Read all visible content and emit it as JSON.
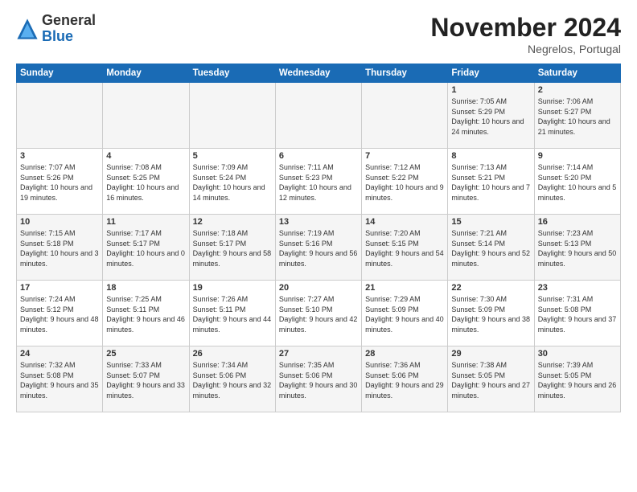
{
  "logo": {
    "general": "General",
    "blue": "Blue"
  },
  "title": "November 2024",
  "location": "Negrelos, Portugal",
  "days_of_week": [
    "Sunday",
    "Monday",
    "Tuesday",
    "Wednesday",
    "Thursday",
    "Friday",
    "Saturday"
  ],
  "weeks": [
    [
      {
        "num": "",
        "info": ""
      },
      {
        "num": "",
        "info": ""
      },
      {
        "num": "",
        "info": ""
      },
      {
        "num": "",
        "info": ""
      },
      {
        "num": "",
        "info": ""
      },
      {
        "num": "1",
        "info": "Sunrise: 7:05 AM\nSunset: 5:29 PM\nDaylight: 10 hours and 24 minutes."
      },
      {
        "num": "2",
        "info": "Sunrise: 7:06 AM\nSunset: 5:27 PM\nDaylight: 10 hours and 21 minutes."
      }
    ],
    [
      {
        "num": "3",
        "info": "Sunrise: 7:07 AM\nSunset: 5:26 PM\nDaylight: 10 hours and 19 minutes."
      },
      {
        "num": "4",
        "info": "Sunrise: 7:08 AM\nSunset: 5:25 PM\nDaylight: 10 hours and 16 minutes."
      },
      {
        "num": "5",
        "info": "Sunrise: 7:09 AM\nSunset: 5:24 PM\nDaylight: 10 hours and 14 minutes."
      },
      {
        "num": "6",
        "info": "Sunrise: 7:11 AM\nSunset: 5:23 PM\nDaylight: 10 hours and 12 minutes."
      },
      {
        "num": "7",
        "info": "Sunrise: 7:12 AM\nSunset: 5:22 PM\nDaylight: 10 hours and 9 minutes."
      },
      {
        "num": "8",
        "info": "Sunrise: 7:13 AM\nSunset: 5:21 PM\nDaylight: 10 hours and 7 minutes."
      },
      {
        "num": "9",
        "info": "Sunrise: 7:14 AM\nSunset: 5:20 PM\nDaylight: 10 hours and 5 minutes."
      }
    ],
    [
      {
        "num": "10",
        "info": "Sunrise: 7:15 AM\nSunset: 5:18 PM\nDaylight: 10 hours and 3 minutes."
      },
      {
        "num": "11",
        "info": "Sunrise: 7:17 AM\nSunset: 5:17 PM\nDaylight: 10 hours and 0 minutes."
      },
      {
        "num": "12",
        "info": "Sunrise: 7:18 AM\nSunset: 5:17 PM\nDaylight: 9 hours and 58 minutes."
      },
      {
        "num": "13",
        "info": "Sunrise: 7:19 AM\nSunset: 5:16 PM\nDaylight: 9 hours and 56 minutes."
      },
      {
        "num": "14",
        "info": "Sunrise: 7:20 AM\nSunset: 5:15 PM\nDaylight: 9 hours and 54 minutes."
      },
      {
        "num": "15",
        "info": "Sunrise: 7:21 AM\nSunset: 5:14 PM\nDaylight: 9 hours and 52 minutes."
      },
      {
        "num": "16",
        "info": "Sunrise: 7:23 AM\nSunset: 5:13 PM\nDaylight: 9 hours and 50 minutes."
      }
    ],
    [
      {
        "num": "17",
        "info": "Sunrise: 7:24 AM\nSunset: 5:12 PM\nDaylight: 9 hours and 48 minutes."
      },
      {
        "num": "18",
        "info": "Sunrise: 7:25 AM\nSunset: 5:11 PM\nDaylight: 9 hours and 46 minutes."
      },
      {
        "num": "19",
        "info": "Sunrise: 7:26 AM\nSunset: 5:11 PM\nDaylight: 9 hours and 44 minutes."
      },
      {
        "num": "20",
        "info": "Sunrise: 7:27 AM\nSunset: 5:10 PM\nDaylight: 9 hours and 42 minutes."
      },
      {
        "num": "21",
        "info": "Sunrise: 7:29 AM\nSunset: 5:09 PM\nDaylight: 9 hours and 40 minutes."
      },
      {
        "num": "22",
        "info": "Sunrise: 7:30 AM\nSunset: 5:09 PM\nDaylight: 9 hours and 38 minutes."
      },
      {
        "num": "23",
        "info": "Sunrise: 7:31 AM\nSunset: 5:08 PM\nDaylight: 9 hours and 37 minutes."
      }
    ],
    [
      {
        "num": "24",
        "info": "Sunrise: 7:32 AM\nSunset: 5:08 PM\nDaylight: 9 hours and 35 minutes."
      },
      {
        "num": "25",
        "info": "Sunrise: 7:33 AM\nSunset: 5:07 PM\nDaylight: 9 hours and 33 minutes."
      },
      {
        "num": "26",
        "info": "Sunrise: 7:34 AM\nSunset: 5:06 PM\nDaylight: 9 hours and 32 minutes."
      },
      {
        "num": "27",
        "info": "Sunrise: 7:35 AM\nSunset: 5:06 PM\nDaylight: 9 hours and 30 minutes."
      },
      {
        "num": "28",
        "info": "Sunrise: 7:36 AM\nSunset: 5:06 PM\nDaylight: 9 hours and 29 minutes."
      },
      {
        "num": "29",
        "info": "Sunrise: 7:38 AM\nSunset: 5:05 PM\nDaylight: 9 hours and 27 minutes."
      },
      {
        "num": "30",
        "info": "Sunrise: 7:39 AM\nSunset: 5:05 PM\nDaylight: 9 hours and 26 minutes."
      }
    ]
  ]
}
